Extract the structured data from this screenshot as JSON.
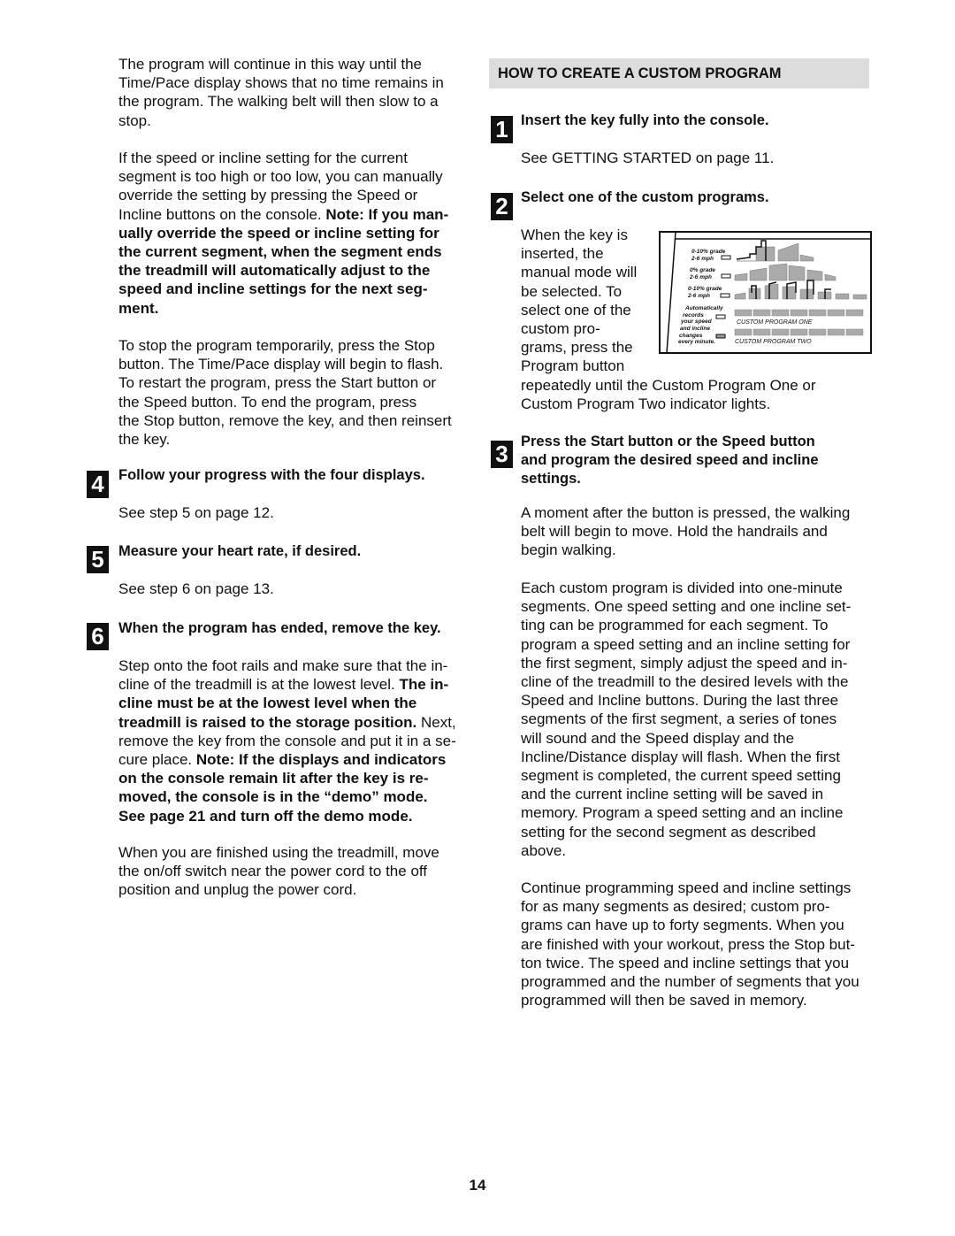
{
  "left": {
    "p1": [
      {
        "t": "The program will continue in this way until the\nTime/Pace display shows that no time remains in\nthe program. The walking belt will then slow to a\nstop."
      }
    ],
    "p2": [
      {
        "t": "If the speed or incline setting for the current\nsegment is too high or too low, you can manually\noverride the setting by pressing the Speed or\nIncline buttons on the console. "
      },
      {
        "t": "Note: If you man-\nually override the speed or incline setting for\nthe current segment, when the segment ends\nthe treadmill will automatically adjust to the\nspeed and incline settings for the next seg-\nment.",
        "b": true
      }
    ],
    "p3": [
      {
        "t": "To stop the program temporarily, press the Stop\nbutton. The Time/Pace display will begin to flash.\nTo restart the program, press the Start button or\nthe Speed     button. To end the program, press\nthe Stop button, remove the key, and then reinsert\nthe key."
      }
    ],
    "step4": {
      "num": "4",
      "heading": "Follow your progress with the four displays.",
      "body": "See step 5 on page 12."
    },
    "step5": {
      "num": "5",
      "heading": "Measure your heart rate, if desired.",
      "body": "See step 6 on page 13."
    },
    "step6": {
      "num": "6",
      "heading": "When the program has ended, remove the key."
    },
    "p6a": [
      {
        "t": "Step onto the foot rails and make sure that the in-\ncline of the treadmill is at the lowest level. "
      },
      {
        "t": "The in-\ncline must be at the lowest level when the\ntreadmill is raised to the storage position.",
        "b": true
      },
      {
        "t": " Next,\nremove the key from the console and put it in a se-\ncure place. "
      },
      {
        "t": "Note: If the displays and indicators\non the console remain lit after the key is re-\nmoved, the console is in the “demo” mode.\nSee page 21 and turn off the demo mode.",
        "b": true
      }
    ],
    "p6b": [
      {
        "t": "When you are finished using the treadmill, move\nthe on/off switch near the power cord to the off\nposition and unplug the power cord."
      }
    ]
  },
  "right": {
    "section_title": "HOW TO CREATE A CUSTOM PROGRAM",
    "step1": {
      "num": "1",
      "heading": "Insert the key fully into the console.",
      "body": "See GETTING STARTED on page 11."
    },
    "step2": {
      "num": "2",
      "heading": "Select one of the custom programs."
    },
    "p2a": [
      {
        "t": "When the key is\ninserted, the\nmanual mode will\nbe selected. To\nselect one of the\ncustom pro-\ngrams, press the\nProgram button"
      }
    ],
    "p2b": [
      {
        "t": "repeatedly until the Custom Program One or\nCustom Program Two indicator lights."
      }
    ],
    "diagram": {
      "row1": [
        "0-10% grade",
        "2-6 mph"
      ],
      "row2": [
        "0% grade",
        "2-6 mph"
      ],
      "row3": [
        "0-10% grade",
        "2-6 mph"
      ],
      "records": [
        "Automatically",
        "records",
        "your speed",
        "and incline",
        "changes",
        "every minute."
      ],
      "program_one": "CUSTOM PROGRAM ONE",
      "program_two": "CUSTOM PROGRAM TWO"
    },
    "step3": {
      "num": "3"
    },
    "step3_heading": [
      {
        "t": "Press the Start button or the Speed     button\nand program the desired speed and incline\nsettings."
      }
    ],
    "p3a": [
      {
        "t": "A moment after the button is pressed, the walking\nbelt will begin to move. Hold the handrails and\nbegin walking."
      }
    ],
    "p3b": [
      {
        "t": "Each custom program is divided into one-minute\nsegments. One speed setting and one incline set-\nting can be programmed for each segment. To\nprogram a speed setting and an incline setting for\nthe first segment, simply adjust the speed and in-\ncline of the treadmill to the desired levels with the\nSpeed and Incline buttons. During the last three\nsegments of the first segment, a series of tones\nwill sound and the Speed display and the\nIncline/Distance display will flash. When the first\nsegment is completed, the current speed setting\nand the current incline setting will be saved in\nmemory. Program a speed setting and an incline\nsetting for the second segment as described\nabove."
      }
    ],
    "p3c": [
      {
        "t": "Continue programming speed and incline settings\nfor as many segments as desired; custom pro-\ngrams can have up to forty segments. When you\nare finished with your workout, press the Stop but-\nton twice. The speed and incline settings that you\nprogrammed and the number of segments that you\nprogrammed will then be saved in memory."
      }
    ]
  },
  "page_number": "14"
}
